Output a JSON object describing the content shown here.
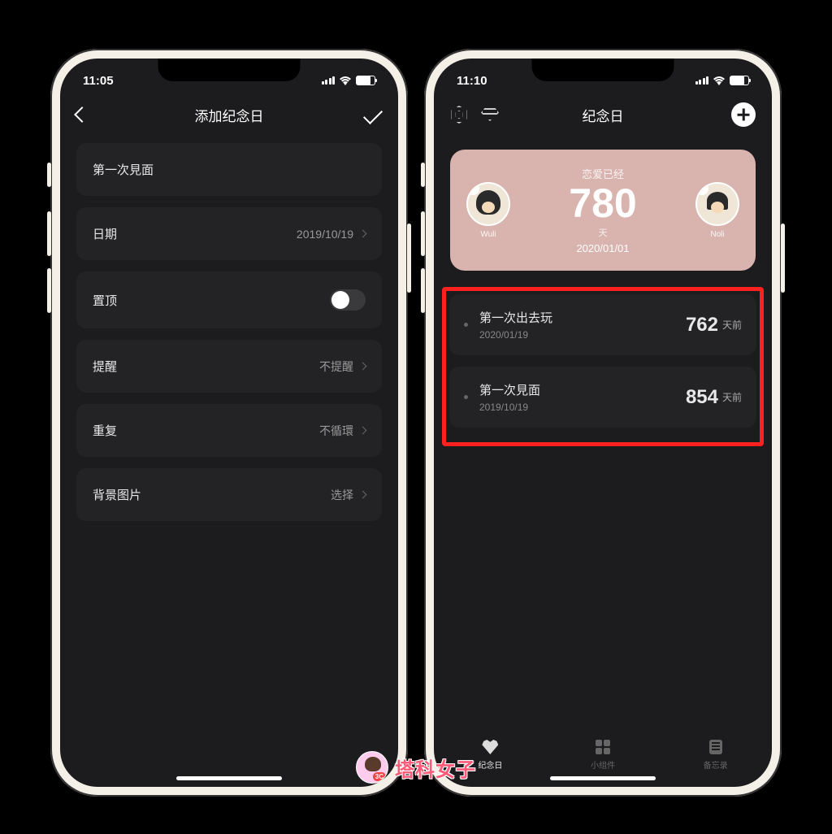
{
  "left": {
    "status_time": "11:05",
    "nav_title": "添加纪念日",
    "rows": {
      "name": "第一次見面",
      "date_label": "日期",
      "date_value": "2019/10/19",
      "pin_label": "置顶",
      "remind_label": "提醒",
      "remind_value": "不提醒",
      "repeat_label": "重复",
      "repeat_value": "不循環",
      "bg_label": "背景图片",
      "bg_value": "选择"
    }
  },
  "right": {
    "status_time": "11:10",
    "nav_title": "纪念日",
    "card": {
      "subtitle": "恋爱已经",
      "days": "780",
      "unit": "天",
      "date": "2020/01/01",
      "left_name": "Wuli",
      "right_name": "Noli"
    },
    "events": [
      {
        "title": "第一次出去玩",
        "date": "2020/01/19",
        "count": "762",
        "suffix": "天前"
      },
      {
        "title": "第一次見面",
        "date": "2019/10/19",
        "count": "854",
        "suffix": "天前"
      }
    ],
    "tabs": {
      "anniversary": "纪念日",
      "widgets": "小组件",
      "memo": "备忘录"
    }
  },
  "watermark": "塔科女子"
}
